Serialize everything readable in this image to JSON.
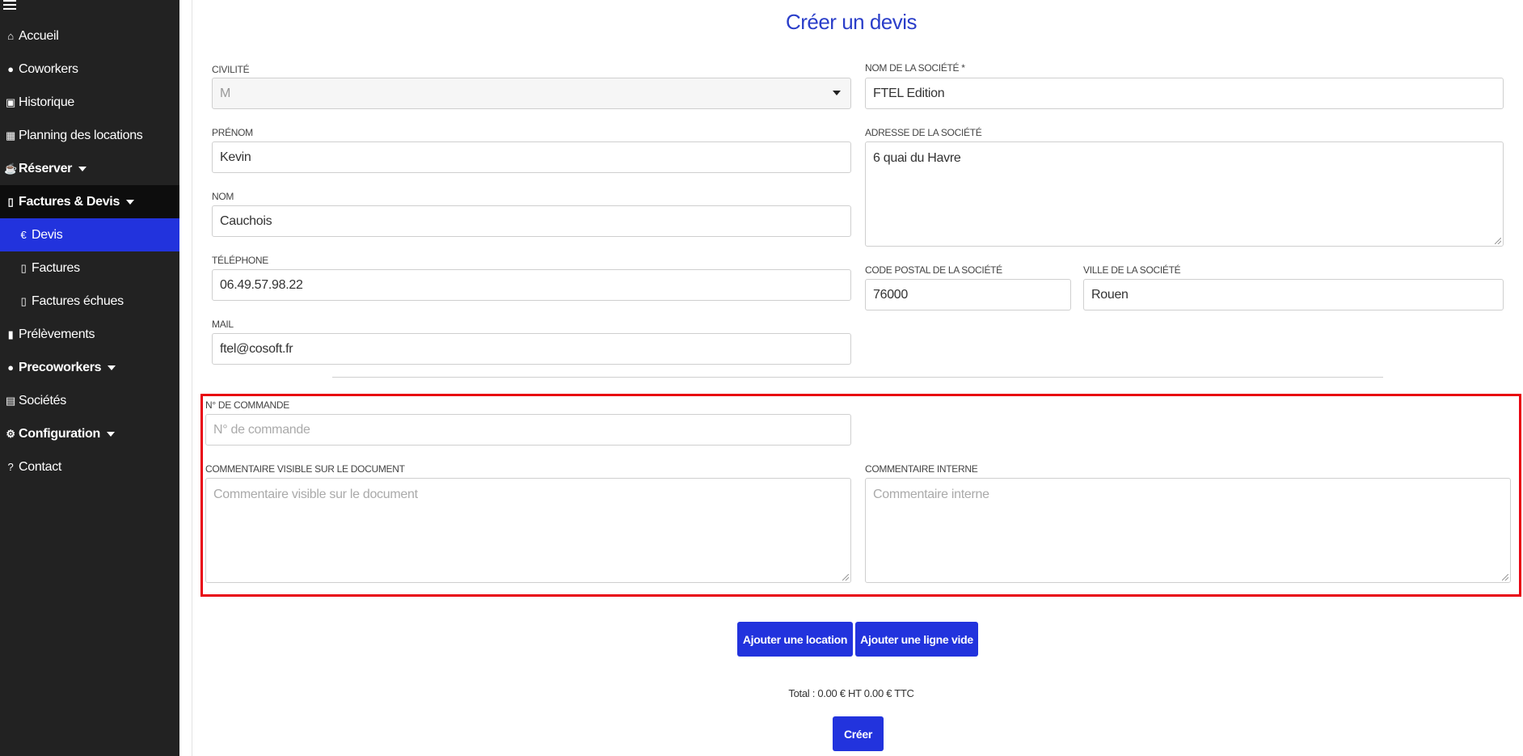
{
  "sidebar": {
    "items": [
      {
        "icon": "home-icon",
        "glyph": "⌂",
        "label": "Accueil"
      },
      {
        "icon": "user-icon",
        "glyph": "●",
        "label": "Coworkers"
      },
      {
        "icon": "money-icon",
        "glyph": "▣",
        "label": "Historique"
      },
      {
        "icon": "calendar-icon",
        "glyph": "▦",
        "label": "Planning des locations"
      },
      {
        "icon": "coffee-icon",
        "glyph": "☕",
        "label": "Réserver"
      },
      {
        "icon": "pdf-file-icon",
        "glyph": "▯",
        "label": "Factures & Devis"
      },
      {
        "icon": "euro-icon",
        "glyph": "€",
        "label": "Devis"
      },
      {
        "icon": "pdf-file-icon",
        "glyph": "▯",
        "label": "Factures"
      },
      {
        "icon": "pdf-file-icon",
        "glyph": "▯",
        "label": "Factures échues"
      },
      {
        "icon": "file-icon",
        "glyph": "▮",
        "label": "Prélèvements"
      },
      {
        "icon": "user-icon",
        "glyph": "●",
        "label": "Precoworkers"
      },
      {
        "icon": "building-icon",
        "glyph": "▤",
        "label": "Sociétés"
      },
      {
        "icon": "gears-icon",
        "glyph": "⚙",
        "label": "Configuration"
      },
      {
        "icon": "help-icon",
        "glyph": "?",
        "label": "Contact"
      }
    ]
  },
  "page": {
    "title": "Créer un devis"
  },
  "form": {
    "civilite": {
      "label": "CIVILITÉ",
      "value": "M"
    },
    "prenom": {
      "label": "PRÉNOM",
      "value": "Kevin"
    },
    "nom": {
      "label": "NOM",
      "value": "Cauchois"
    },
    "telephone": {
      "label": "TÉLÉPHONE",
      "value": "06.49.57.98.22"
    },
    "mail": {
      "label": "MAIL",
      "value": "ftel@cosoft.fr"
    },
    "societe_nom": {
      "label": "NOM DE LA SOCIÉTÉ *",
      "value": "FTEL Edition"
    },
    "societe_adresse": {
      "label": "ADRESSE DE LA SOCIÉTÉ",
      "value": "6 quai du Havre"
    },
    "societe_cp": {
      "label": "CODE POSTAL DE LA SOCIÉTÉ",
      "value": "76000"
    },
    "societe_ville": {
      "label": "VILLE DE LA SOCIÉTÉ",
      "value": "Rouen"
    },
    "commande": {
      "label": "N° DE COMMANDE",
      "placeholder": "N° de commande"
    },
    "commentaire_visible": {
      "label": "COMMENTAIRE VISIBLE SUR LE DOCUMENT",
      "placeholder": "Commentaire visible sur le document"
    },
    "commentaire_interne": {
      "label": "COMMENTAIRE INTERNE",
      "placeholder": "Commentaire interne"
    }
  },
  "actions": {
    "add_location": "Ajouter une location",
    "add_empty_line": "Ajouter une ligne vide",
    "total": "Total : 0.00 € HT 0.00 € TTC",
    "create": "Créer"
  },
  "colors": {
    "sidebar_bg": "#222222",
    "accent": "#2233dd",
    "highlight": "#e8000f"
  }
}
